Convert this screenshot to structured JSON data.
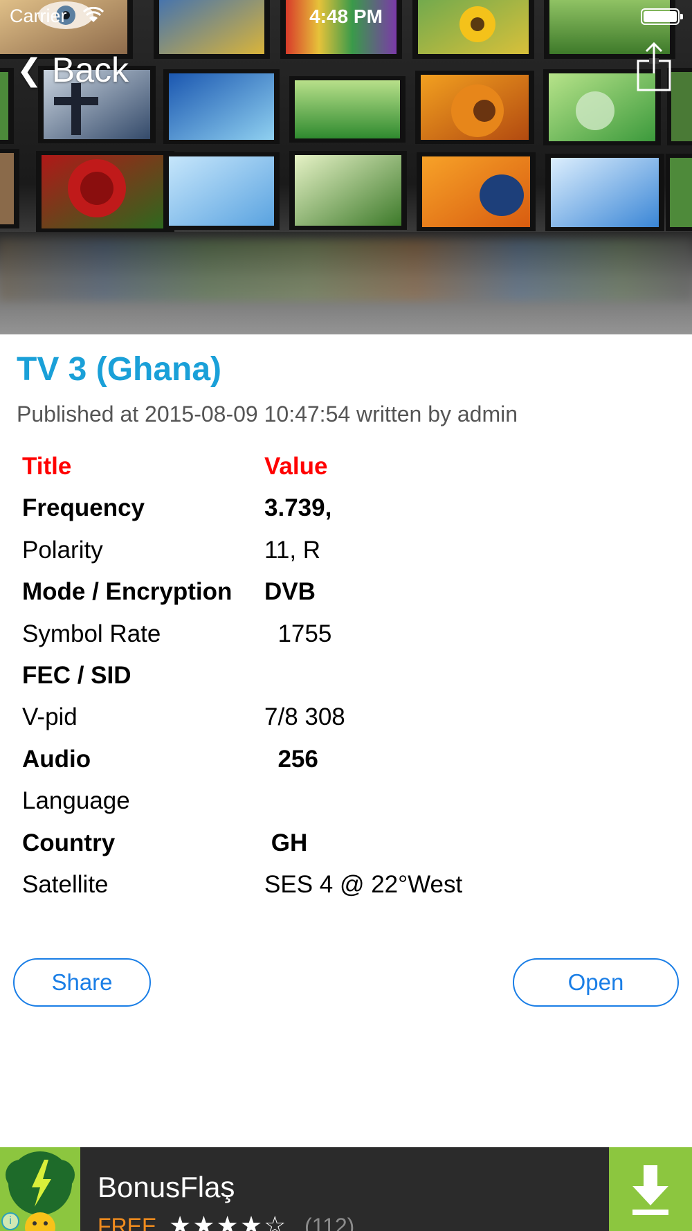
{
  "status_bar": {
    "carrier": "Carrier",
    "time": "4:48 PM"
  },
  "nav": {
    "back_label": "Back",
    "back_icon": "chevron-left-icon",
    "share_icon": "share-icon"
  },
  "article": {
    "title": "TV 3 (Ghana)",
    "meta": "Published at 2015-08-09 10:47:54 written by admin",
    "title_color": "#1aa0d8"
  },
  "table": {
    "header": {
      "title": "Title",
      "value": "Value"
    },
    "rows": [
      {
        "title": "Frequency",
        "value": "3.739,"
      },
      {
        "title": "Polarity",
        "value": "11, R"
      },
      {
        "title": "Mode / Encryption",
        "value": "DVB"
      },
      {
        "title": "Symbol Rate",
        "value": "  1755"
      },
      {
        "title": "FEC / SID",
        "value": ""
      },
      {
        "title": "V-pid",
        "value": "7/8 308"
      },
      {
        "title": "Audio",
        "value": "  256"
      },
      {
        "title": "Language",
        "value": ""
      },
      {
        "title": "Country",
        "value": " GH"
      },
      {
        "title": "Satellite",
        "value": "SES 4 @ 22°West"
      }
    ]
  },
  "buttons": {
    "share": "Share",
    "open": "Open",
    "accent": "#1a7ee6"
  },
  "ad": {
    "title": "BonusFlaş",
    "price": "FREE",
    "rating_stars": "★★★★☆",
    "rating_value": 4,
    "rating_count": "(112)",
    "download_icon": "download-icon",
    "info_icon": "info-icon",
    "accent": "#8cc63f"
  }
}
